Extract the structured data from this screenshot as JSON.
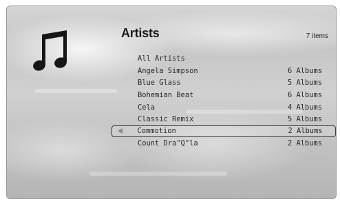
{
  "header": {
    "title": "Artists",
    "item_count": "7 items",
    "icon": "music-note-icon"
  },
  "artists": [
    {
      "name": "All Artists",
      "albums": ""
    },
    {
      "name": "Angela Simpson",
      "albums": "6 Albums"
    },
    {
      "name": "Blue Glass",
      "albums": "5 Albums"
    },
    {
      "name": "Bohemian Beat",
      "albums": "6 Albums"
    },
    {
      "name": "Cela",
      "albums": "4 Albums"
    },
    {
      "name": "Classic Remix",
      "albums": "5 Albums"
    },
    {
      "name": "Commotion",
      "albums": "2 Albums",
      "selected": true
    },
    {
      "name": "Count Dra\"Q\"la",
      "albums": "2 Albums"
    }
  ],
  "colors": {
    "text": "#2a2a2a",
    "selection_border": "#3a3a3a",
    "arrow": "#8a8a8a"
  }
}
